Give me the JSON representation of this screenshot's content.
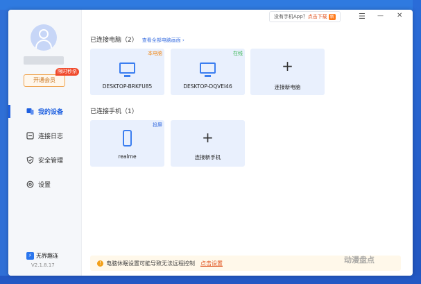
{
  "header": {
    "promo_text": "没有手机App？",
    "promo_link": "点击下载",
    "promo_badge": "新",
    "menu_glyph": "☰",
    "minimize_glyph": "—",
    "close_glyph": "✕"
  },
  "sidebar": {
    "vip_button": "开通会员",
    "vip_badge": "限时秒杀",
    "items": [
      {
        "label": "我的设备",
        "active": true
      },
      {
        "label": "连接日志",
        "active": false
      },
      {
        "label": "安全管理",
        "active": false
      },
      {
        "label": "设置",
        "active": false
      }
    ],
    "brand": "无界趣连",
    "version": "V2.1.8.17"
  },
  "computers": {
    "title": "已连接电脑（2）",
    "link": "查看全部电脑画面 ›",
    "cards": [
      {
        "name": "DESKTOP-BRKFU85",
        "tag": "本电脑",
        "tag_color": "#f08a1c"
      },
      {
        "name": "DESKTOP-DQVEI46",
        "tag": "在线",
        "tag_color": "#2fb34a"
      }
    ],
    "add_label": "连接新电脑",
    "add_glyph": "+"
  },
  "phones": {
    "title": "已连接手机（1）",
    "cards": [
      {
        "name": "realme",
        "tag": "投屏",
        "tag_color": "#3a6fe0"
      }
    ],
    "add_label": "连接新手机",
    "add_glyph": "+"
  },
  "notice": {
    "icon_glyph": "!",
    "text": "电脑休眠设置可能导致无法远程控制",
    "action": "点击设置"
  },
  "watermark": "动漫盘点",
  "colors": {
    "accent": "#1d5fe0",
    "card_bg": "#e9f0fd",
    "background": "#2f6fd6"
  }
}
